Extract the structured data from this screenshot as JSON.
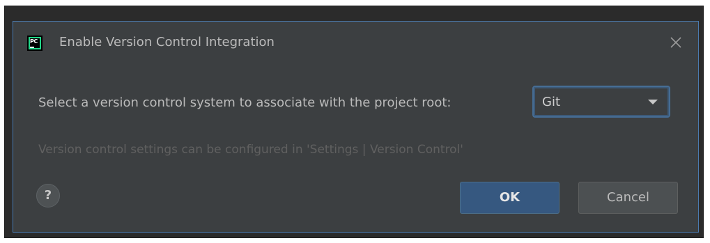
{
  "dialog": {
    "title": "Enable Version Control Integration",
    "app_icon_text": "PC",
    "close_icon": "close-icon",
    "prompt_label": "Select a version control system to associate with the project root:",
    "vcs_select": {
      "value": "Git"
    },
    "hint": "Version control settings can be configured in 'Settings | Version Control'",
    "help_label": "?",
    "ok_label": "OK",
    "cancel_label": "Cancel"
  },
  "colors": {
    "dialog_bg": "#3c3f41",
    "accent_border": "#4b7bb0",
    "primary_button": "#365880",
    "secondary_button": "#4c5052",
    "app_icon_green": "#21d789"
  }
}
